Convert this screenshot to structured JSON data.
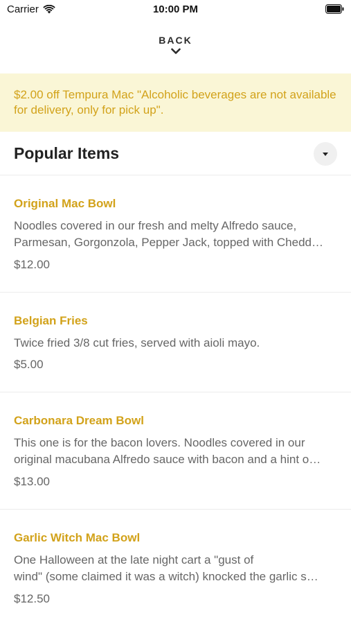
{
  "status_bar": {
    "carrier": "Carrier",
    "time": "10:00 PM",
    "icons": [
      "wifi-icon",
      "battery-icon"
    ]
  },
  "nav": {
    "back_label": "BACK",
    "back_icon": "chevron-down-icon"
  },
  "promo": {
    "text": "$2.00 off Tempura Mac \"Alcoholic beverages are not available for delivery, only for pick up\"."
  },
  "section": {
    "title": "Popular Items",
    "toggle_icon": "caret-down-icon"
  },
  "colors": {
    "accent": "#d2a21a",
    "promo_bg": "#faf6d6",
    "body_text": "#666666"
  },
  "items": [
    {
      "name": "Original Mac Bowl",
      "desc_lines": [
        "Noodles covered in our fresh and melty Alfredo sauce,",
        "Parmesan, Gorgonzola, Pepper Jack, topped with Chedd…"
      ],
      "price": "$12.00"
    },
    {
      "name": "Belgian Fries",
      "desc_lines": [
        "Twice fried 3/8 cut fries, served with aioli mayo."
      ],
      "price": "$5.00"
    },
    {
      "name": "Carbonara Dream Bowl",
      "desc_lines": [
        "This one is for the bacon lovers. Noodles covered in our",
        "original macubana Alfredo sauce with bacon and a hint o…"
      ],
      "price": "$13.00"
    },
    {
      "name": "Garlic Witch Mac Bowl",
      "desc_lines": [
        "One Halloween at the late night cart a \"gust of",
        "wind\" (some claimed it was a witch) knocked the garlic s…"
      ],
      "price": "$12.50"
    }
  ]
}
